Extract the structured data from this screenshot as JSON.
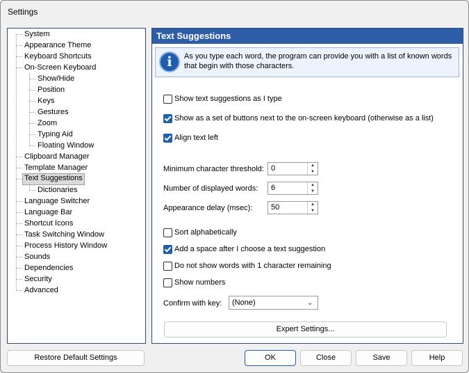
{
  "window": {
    "title": "Settings"
  },
  "tree": {
    "items": [
      {
        "label": "System"
      },
      {
        "label": "Appearance Theme"
      },
      {
        "label": "Keyboard Shortcuts"
      },
      {
        "label": "On-Screen Keyboard"
      },
      {
        "label": "Show/Hide"
      },
      {
        "label": "Position"
      },
      {
        "label": "Keys"
      },
      {
        "label": "Gestures"
      },
      {
        "label": "Zoom"
      },
      {
        "label": "Typing Aid"
      },
      {
        "label": "Floating Window"
      },
      {
        "label": "Clipboard Manager"
      },
      {
        "label": "Template Manager"
      },
      {
        "label": "Text Suggestions"
      },
      {
        "label": "Dictionaries"
      },
      {
        "label": "Language Switcher"
      },
      {
        "label": "Language Bar"
      },
      {
        "label": "Shortcut Icons"
      },
      {
        "label": "Task Switching Window"
      },
      {
        "label": "Process History Window"
      },
      {
        "label": "Sounds"
      },
      {
        "label": "Dependencies"
      },
      {
        "label": "Security"
      },
      {
        "label": "Advanced"
      }
    ],
    "selected": "Text Suggestions"
  },
  "panel": {
    "title": "Text Suggestions",
    "info": "As you type each word, the program can provide you with a list of known words that begin with those characters.",
    "options": {
      "show_suggestions": {
        "label": "Show text suggestions as I type",
        "checked": false
      },
      "show_as_buttons": {
        "label": "Show as a set of buttons next to the on-screen keyboard (otherwise as a list)",
        "checked": true
      },
      "align_left": {
        "label": "Align text left",
        "checked": true
      },
      "sort_alpha": {
        "label": "Sort alphabetically",
        "checked": false
      },
      "add_space": {
        "label": "Add a space after I choose a text suggestion",
        "checked": true
      },
      "no_one_char": {
        "label": "Do not show words with 1 character remaining",
        "checked": false
      },
      "show_numbers": {
        "label": "Show numbers",
        "checked": false
      }
    },
    "fields": {
      "min_threshold": {
        "label": "Minimum character threshold:",
        "value": "0"
      },
      "num_words": {
        "label": "Number of displayed words:",
        "value": "6"
      },
      "delay": {
        "label": "Appearance delay (msec):",
        "value": "50"
      }
    },
    "confirm": {
      "label": "Confirm with key:",
      "value": "(None)"
    },
    "expert_button": "Expert Settings..."
  },
  "footer": {
    "restore": "Restore Default Settings",
    "ok": "OK",
    "close": "Close",
    "save": "Save",
    "help": "Help"
  }
}
